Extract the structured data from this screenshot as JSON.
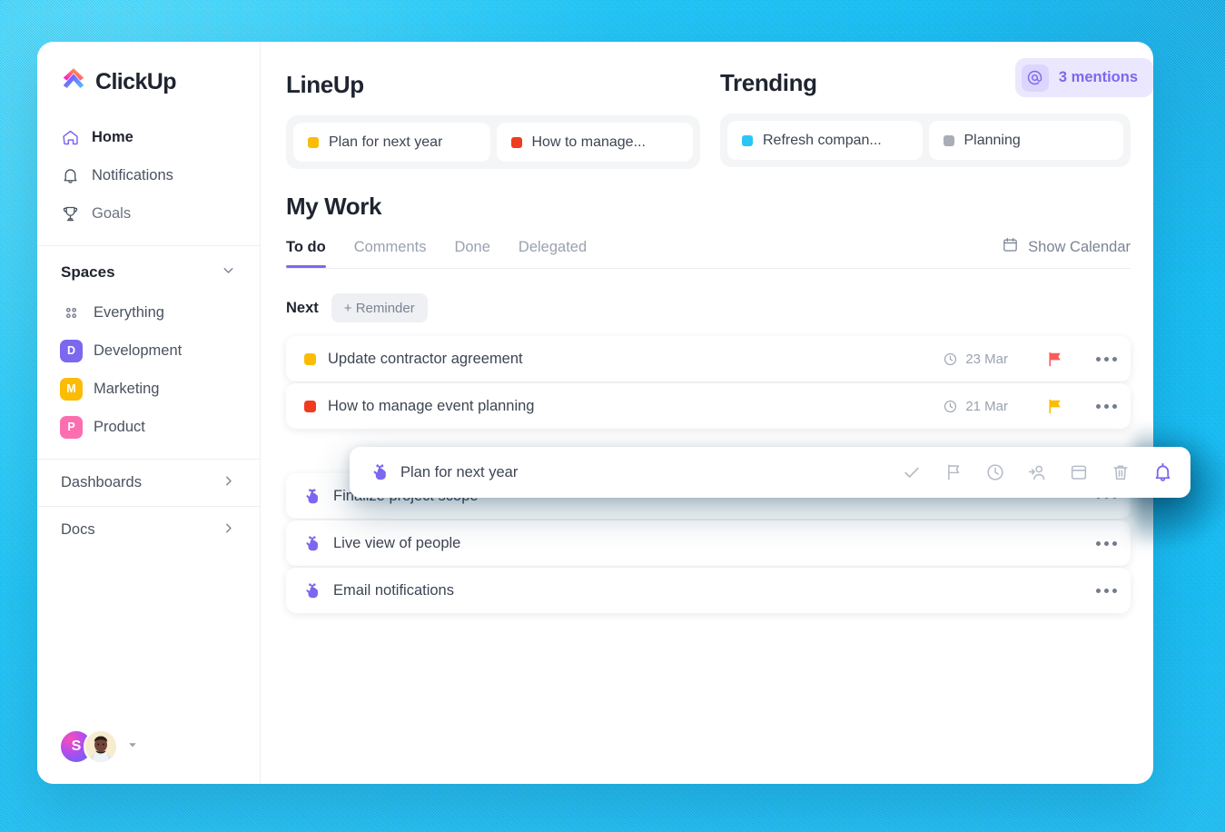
{
  "app": {
    "logo_text": "ClickUp"
  },
  "sidebar": {
    "nav": [
      {
        "label": "Home",
        "icon": "home-icon",
        "active": true
      },
      {
        "label": "Notifications",
        "icon": "bell-icon",
        "active": false
      },
      {
        "label": "Goals",
        "icon": "trophy-icon",
        "active": false
      }
    ],
    "spaces_title": "Spaces",
    "spaces": [
      {
        "label": "Everything",
        "initial": "",
        "color": "#9aa1ae"
      },
      {
        "label": "Development",
        "initial": "D",
        "color": "#7b68ee"
      },
      {
        "label": "Marketing",
        "initial": "M",
        "color": "#fbbc05"
      },
      {
        "label": "Product",
        "initial": "P",
        "color": "#fb6fb0"
      }
    ],
    "rows": [
      {
        "label": "Dashboards"
      },
      {
        "label": "Docs"
      }
    ],
    "avatars": [
      {
        "initial": "S",
        "type": "gradient"
      },
      {
        "initial": "",
        "type": "photo"
      }
    ]
  },
  "lineup": {
    "title": "LineUp",
    "chips": [
      {
        "label": "Plan for next year",
        "color": "#fbbc05"
      },
      {
        "label": "How to manage...",
        "color": "#f03b20"
      }
    ]
  },
  "trending": {
    "title": "Trending",
    "chips": [
      {
        "label": "Refresh compan...",
        "color": "#29c5f6"
      },
      {
        "label": "Planning",
        "color": "#a8adb7"
      }
    ]
  },
  "mentions": {
    "label": "3 mentions",
    "icon": "at-icon",
    "accent": "#7b68ee"
  },
  "my_work": {
    "title": "My Work",
    "tabs": [
      {
        "label": "To do",
        "active": true
      },
      {
        "label": "Comments",
        "active": false
      },
      {
        "label": "Done",
        "active": false
      },
      {
        "label": "Delegated",
        "active": false
      }
    ],
    "show_calendar": "Show Calendar",
    "next_label": "Next",
    "add_reminder": "+ Reminder",
    "tasks_top": [
      {
        "title": "Update contractor agreement",
        "dot": "#fbbc05",
        "due": "23 Mar",
        "flag": "#fb5a5a"
      },
      {
        "title": "How to manage event planning",
        "dot": "#f03b20",
        "due": "21 Mar",
        "flag": "#fbbc05"
      }
    ],
    "tasks_bottom": [
      {
        "title": "Finalize project scope",
        "icon": "reminder-hand-icon"
      },
      {
        "title": "Live view of people",
        "icon": "reminder-hand-icon"
      },
      {
        "title": "Email notifications",
        "icon": "reminder-hand-icon"
      }
    ]
  },
  "floating_card": {
    "title": "Plan for next year",
    "icon": "reminder-hand-icon",
    "actions": [
      {
        "name": "check-icon",
        "active": false
      },
      {
        "name": "flag-icon",
        "active": false
      },
      {
        "name": "clock-icon",
        "active": false
      },
      {
        "name": "assign-user-icon",
        "active": false
      },
      {
        "name": "calendar-icon",
        "active": false
      },
      {
        "name": "trash-icon",
        "active": false
      },
      {
        "name": "bell-icon",
        "active": true
      }
    ],
    "active_color": "#7b68ee"
  }
}
